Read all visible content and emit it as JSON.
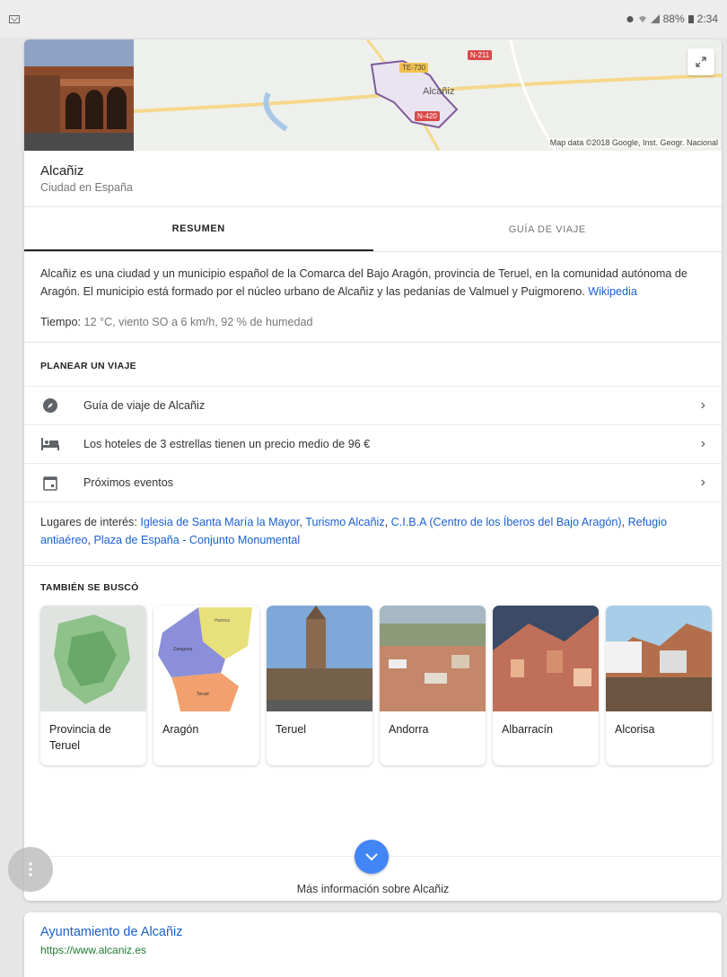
{
  "status_bar": {
    "battery": "88%",
    "time": "2:34"
  },
  "map": {
    "credit": "Map data ©2018 Google, Inst. Geogr. Nacional",
    "city_label": "Alcañiz",
    "roads": [
      "N-211",
      "TE-730",
      "N-420"
    ]
  },
  "place": {
    "name": "Alcañiz",
    "subtitle": "Ciudad en España"
  },
  "tabs": [
    {
      "label": "RESUMEN",
      "active": true
    },
    {
      "label": "GUÍA DE VIAJE",
      "active": false
    }
  ],
  "summary": {
    "text": "Alcañiz es una ciudad y un municipio español de la Comarca del Bajo Aragón, provincia de Teruel, en la comunidad autónoma de Aragón. El municipio está formado por el núcleo urbano de Alcañiz y las pedanías de Valmuel y Puigmoreno.",
    "source_link": "Wikipedia",
    "weather_label": "Tiempo:",
    "weather_value": "12 °C, viento SO a 6 km/h, 92 % de humedad"
  },
  "plan": {
    "heading": "PLANEAR UN VIAJE",
    "items": [
      {
        "label": "Guía de viaje de Alcañiz",
        "icon": "compass-icon"
      },
      {
        "label": "Los hoteles de 3 estrellas tienen un precio medio de 96 €",
        "icon": "hotel-bed-icon"
      },
      {
        "label": "Próximos eventos",
        "icon": "calendar-icon"
      }
    ]
  },
  "pois": {
    "label": "Lugares de interés:",
    "links": [
      "Iglesia de Santa María la Mayor",
      "Turismo Alcañiz",
      "C.I.B.A (Centro de los Íberos del Bajo Aragón)",
      "Refugio antiaéreo",
      "Plaza de España - Conjunto Monumental"
    ]
  },
  "also_searched": {
    "heading": "TAMBIÉN SE BUSCÓ",
    "items": [
      "Provincia de Teruel",
      "Aragón",
      "Teruel",
      "Andorra",
      "Albarracín",
      "Alcorisa"
    ],
    "map_labels": [
      "Huesca",
      "Zaragoza",
      "Teruel"
    ]
  },
  "more": {
    "label": "Más información sobre Alcañiz"
  },
  "result": {
    "title": "Ayuntamiento de Alcañiz",
    "url": "https://www.alcaniz.es"
  },
  "colors": {
    "link": "#1a5fd0",
    "url": "#1e7b34",
    "accent": "#4285f4"
  }
}
